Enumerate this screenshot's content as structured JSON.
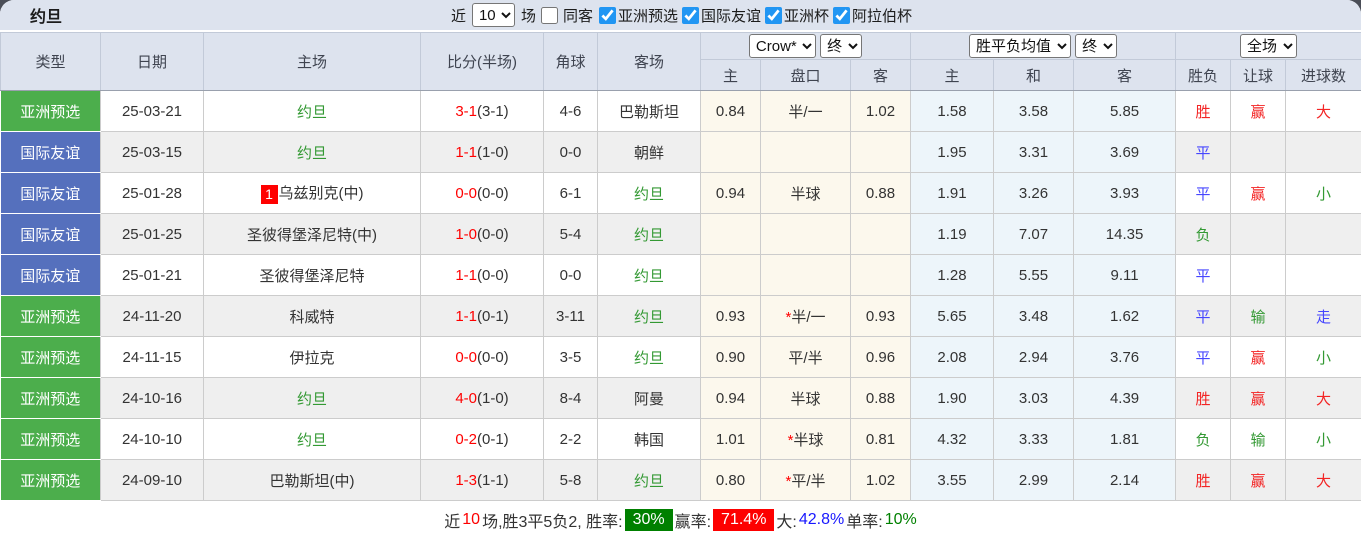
{
  "colors": {
    "header_bg": "#dde3ee",
    "badge_green": "#4cae4c",
    "badge_blue": "#5570bd",
    "team_green": "#339933",
    "score_red": "#ff0000",
    "win_red": "#f32424",
    "draw_blue": "#4646ff",
    "lose_green": "#339933",
    "odds_cream_bg": "#fcf8ed",
    "euro_blue_bg": "#edf5fa",
    "row_alt_bg": "#efefef",
    "checkbox_blue": "#2196f3",
    "summary_green_bg": "#008000",
    "summary_red_bg": "#fd0000"
  },
  "topbar": {
    "title": "约旦",
    "near_label": "近",
    "near_count": "10",
    "games_label": "场",
    "same_away_label": "同客",
    "comps": [
      {
        "label": "亚洲预选",
        "checked": true
      },
      {
        "label": "国际友谊",
        "checked": true
      },
      {
        "label": "亚洲杯",
        "checked": true
      },
      {
        "label": "阿拉伯杯",
        "checked": true
      }
    ]
  },
  "table": {
    "dropdowns": {
      "bookmaker": "Crow*",
      "bookmaker_time": "终",
      "odds_avg": "胜平负均值",
      "odds_time": "终",
      "scope": "全场"
    },
    "columns": {
      "type": "类型",
      "date": "日期",
      "home": "主场",
      "score": "比分(半场)",
      "corner": "角球",
      "away": "客场",
      "ah_home": "主",
      "ah_line": "盘口",
      "ah_away": "客",
      "eu_home": "主",
      "eu_draw": "和",
      "eu_away": "客",
      "result": "胜负",
      "handicap": "让球",
      "goals": "进球数"
    },
    "rows": [
      {
        "type": "亚洲预选",
        "type_class": "badge-green",
        "date": "25-03-21",
        "rank": "",
        "home": "约旦",
        "home_class": "green",
        "score_ft": "3-1",
        "score_ht": "(3-1)",
        "corner": "4-6",
        "away": "巴勒斯坦",
        "away_class": "",
        "ah_home": "0.84",
        "ah_star": "",
        "ah_line": "半/一",
        "ah_away": "1.02",
        "eu_home": "1.58",
        "eu_draw": "3.58",
        "eu_away": "5.85",
        "result": "胜",
        "result_class": "red",
        "handicap": "赢",
        "handicap_class": "red",
        "goals": "大",
        "goals_class": "red"
      },
      {
        "type": "国际友谊",
        "type_class": "badge-blue",
        "date": "25-03-15",
        "rank": "",
        "home": "约旦",
        "home_class": "green",
        "score_ft": "1-1",
        "score_ht": "(1-0)",
        "corner": "0-0",
        "away": "朝鲜",
        "away_class": "",
        "ah_home": "",
        "ah_star": "",
        "ah_line": "",
        "ah_away": "",
        "eu_home": "1.95",
        "eu_draw": "3.31",
        "eu_away": "3.69",
        "result": "平",
        "result_class": "blue",
        "handicap": "",
        "handicap_class": "",
        "goals": "",
        "goals_class": ""
      },
      {
        "type": "国际友谊",
        "type_class": "badge-blue",
        "date": "25-01-28",
        "rank": "1",
        "home": "乌兹别克(中)",
        "home_class": "",
        "score_ft": "0-0",
        "score_ht": "(0-0)",
        "corner": "6-1",
        "away": "约旦",
        "away_class": "green",
        "ah_home": "0.94",
        "ah_star": "",
        "ah_line": "半球",
        "ah_away": "0.88",
        "eu_home": "1.91",
        "eu_draw": "3.26",
        "eu_away": "3.93",
        "result": "平",
        "result_class": "blue",
        "handicap": "赢",
        "handicap_class": "red",
        "goals": "小",
        "goals_class": "green"
      },
      {
        "type": "国际友谊",
        "type_class": "badge-blue",
        "date": "25-01-25",
        "rank": "",
        "home": "圣彼得堡泽尼特(中)",
        "home_class": "",
        "score_ft": "1-0",
        "score_ht": "(0-0)",
        "corner": "5-4",
        "away": "约旦",
        "away_class": "green",
        "ah_home": "",
        "ah_star": "",
        "ah_line": "",
        "ah_away": "",
        "eu_home": "1.19",
        "eu_draw": "7.07",
        "eu_away": "14.35",
        "result": "负",
        "result_class": "green",
        "handicap": "",
        "handicap_class": "",
        "goals": "",
        "goals_class": ""
      },
      {
        "type": "国际友谊",
        "type_class": "badge-blue",
        "date": "25-01-21",
        "rank": "",
        "home": "圣彼得堡泽尼特",
        "home_class": "",
        "score_ft": "1-1",
        "score_ht": "(0-0)",
        "corner": "0-0",
        "away": "约旦",
        "away_class": "green",
        "ah_home": "",
        "ah_star": "",
        "ah_line": "",
        "ah_away": "",
        "eu_home": "1.28",
        "eu_draw": "5.55",
        "eu_away": "9.11",
        "result": "平",
        "result_class": "blue",
        "handicap": "",
        "handicap_class": "",
        "goals": "",
        "goals_class": ""
      },
      {
        "type": "亚洲预选",
        "type_class": "badge-green",
        "date": "24-11-20",
        "rank": "",
        "home": "科威特",
        "home_class": "",
        "score_ft": "1-1",
        "score_ht": "(0-1)",
        "corner": "3-11",
        "away": "约旦",
        "away_class": "green",
        "ah_home": "0.93",
        "ah_star": "*",
        "ah_line": "半/一",
        "ah_away": "0.93",
        "eu_home": "5.65",
        "eu_draw": "3.48",
        "eu_away": "1.62",
        "result": "平",
        "result_class": "blue",
        "handicap": "输",
        "handicap_class": "green",
        "goals": "走",
        "goals_class": "blue"
      },
      {
        "type": "亚洲预选",
        "type_class": "badge-green",
        "date": "24-11-15",
        "rank": "",
        "home": "伊拉克",
        "home_class": "",
        "score_ft": "0-0",
        "score_ht": "(0-0)",
        "corner": "3-5",
        "away": "约旦",
        "away_class": "green",
        "ah_home": "0.90",
        "ah_star": "",
        "ah_line": "平/半",
        "ah_away": "0.96",
        "eu_home": "2.08",
        "eu_draw": "2.94",
        "eu_away": "3.76",
        "result": "平",
        "result_class": "blue",
        "handicap": "赢",
        "handicap_class": "red",
        "goals": "小",
        "goals_class": "green"
      },
      {
        "type": "亚洲预选",
        "type_class": "badge-green",
        "date": "24-10-16",
        "rank": "",
        "home": "约旦",
        "home_class": "green",
        "score_ft": "4-0",
        "score_ht": "(1-0)",
        "corner": "8-4",
        "away": "阿曼",
        "away_class": "",
        "ah_home": "0.94",
        "ah_star": "",
        "ah_line": "半球",
        "ah_away": "0.88",
        "eu_home": "1.90",
        "eu_draw": "3.03",
        "eu_away": "4.39",
        "result": "胜",
        "result_class": "red",
        "handicap": "赢",
        "handicap_class": "red",
        "goals": "大",
        "goals_class": "red"
      },
      {
        "type": "亚洲预选",
        "type_class": "badge-green",
        "date": "24-10-10",
        "rank": "",
        "home": "约旦",
        "home_class": "green",
        "score_ft": "0-2",
        "score_ht": "(0-1)",
        "corner": "2-2",
        "away": "韩国",
        "away_class": "",
        "ah_home": "1.01",
        "ah_star": "*",
        "ah_line": "半球",
        "ah_away": "0.81",
        "eu_home": "4.32",
        "eu_draw": "3.33",
        "eu_away": "1.81",
        "result": "负",
        "result_class": "green",
        "handicap": "输",
        "handicap_class": "green",
        "goals": "小",
        "goals_class": "green"
      },
      {
        "type": "亚洲预选",
        "type_class": "badge-green",
        "date": "24-09-10",
        "rank": "",
        "home": "巴勒斯坦(中)",
        "home_class": "",
        "score_ft": "1-3",
        "score_ht": "(1-1)",
        "corner": "5-8",
        "away": "约旦",
        "away_class": "green",
        "ah_home": "0.80",
        "ah_star": "*",
        "ah_line": "平/半",
        "ah_away": "1.02",
        "eu_home": "3.55",
        "eu_draw": "2.99",
        "eu_away": "2.14",
        "result": "胜",
        "result_class": "red",
        "handicap": "赢",
        "handicap_class": "red",
        "goals": "大",
        "goals_class": "red"
      }
    ]
  },
  "summary": {
    "s1": "近",
    "count": "10",
    "s2": "场,胜3平5负2, 胜率:",
    "win_rate": "30%",
    "s3": "赢率:",
    "handicap_rate": "71.4%",
    "s4": "大:",
    "big_rate": "42.8%",
    "s5": "单率:",
    "single_rate": "10%"
  }
}
